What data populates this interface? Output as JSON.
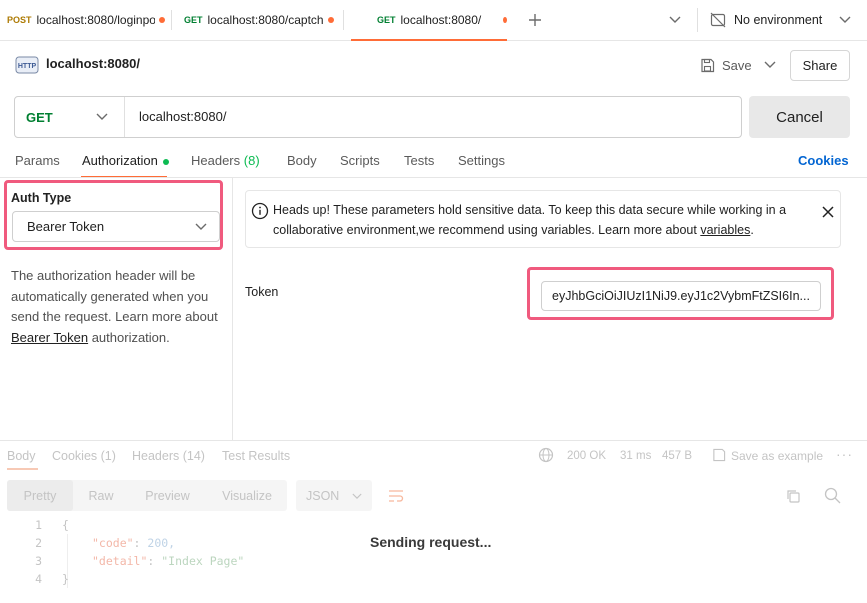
{
  "tabs": [
    {
      "method": "POST",
      "label": "localhost:8080/loginpo"
    },
    {
      "method": "GET",
      "label": "localhost:8080/captch"
    },
    {
      "method": "GET",
      "label": "localhost:8080/"
    }
  ],
  "environment": "No environment",
  "request": {
    "title": "localhost:8080/",
    "save_label": "Save",
    "share_label": "Share",
    "method": "GET",
    "url": "localhost:8080/",
    "cancel_label": "Cancel"
  },
  "request_tabs": {
    "params": "Params",
    "authorization": "Authorization",
    "headers": "Headers",
    "headers_count": "(8)",
    "body": "Body",
    "scripts": "Scripts",
    "tests": "Tests",
    "settings": "Settings",
    "cookies": "Cookies"
  },
  "auth": {
    "type_label": "Auth Type",
    "type_value": "Bearer Token",
    "desc_1": "The authorization header will be automatically generated when you send the request. Learn more about ",
    "desc_link": "Bearer Token",
    "desc_2": " authorization.",
    "notice_1": "Heads up! These parameters hold sensitive data. To keep this data secure while working in a collaborative environment,we recommend using variables. Learn more about ",
    "notice_link": "variables",
    "notice_2": ".",
    "token_label": "Token",
    "token_value": "eyJhbGciOiJIUzI1NiJ9.eyJ1c2VybmFtZSI6In..."
  },
  "response": {
    "tabs": {
      "body": "Body",
      "cookies": "Cookies (1)",
      "headers": "Headers (14)",
      "tests": "Test Results"
    },
    "status": "200 OK",
    "time": "31 ms",
    "size": "457 B",
    "save_example": "Save as example",
    "views": {
      "pretty": "Pretty",
      "raw": "Raw",
      "preview": "Preview",
      "visualize": "Visualize",
      "format": "JSON"
    },
    "line_numbers": [
      "1",
      "2",
      "3",
      "4"
    ],
    "code": {
      "open": "{",
      "key1": "\"code\"",
      "val1": "200,",
      "key2": "\"detail\"",
      "val2": "\"Index Page\"",
      "close": "}"
    },
    "sending": "Sending request..."
  },
  "colors": {
    "accent": "#ff6c37",
    "highlight": "#f05a7e",
    "get": "#007f31",
    "post": "#ad7a03",
    "link": "#0265d2"
  }
}
